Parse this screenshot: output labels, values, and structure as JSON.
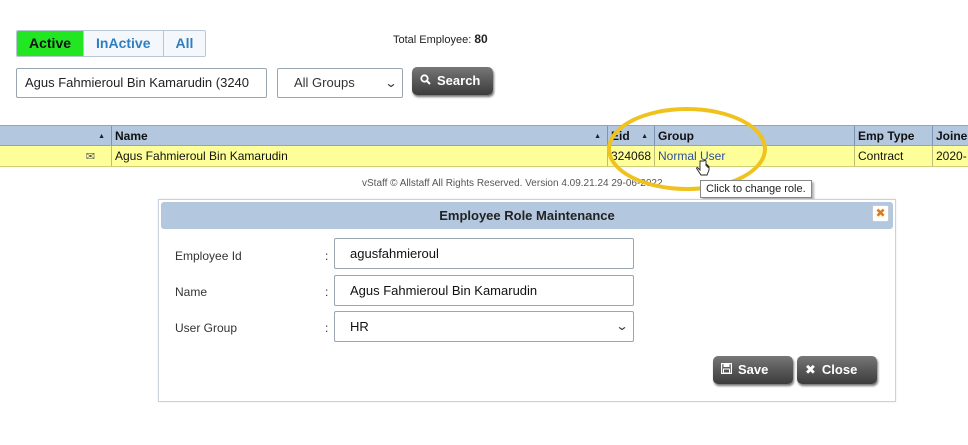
{
  "filters": {
    "tabs": [
      "Active",
      "InActive",
      "All"
    ],
    "active": "Active"
  },
  "summary": {
    "label": "Total Employee:",
    "count": "80"
  },
  "search": {
    "value": "Agus Fahmieroul Bin Kamarudin (3240",
    "group": "All Groups",
    "button": "Search"
  },
  "table": {
    "headers": [
      "",
      "Name",
      "Eid",
      "Group",
      "Emp Type",
      "Joine"
    ],
    "row": {
      "name": "Agus Fahmieroul Bin Kamarudin",
      "eid": "324068",
      "group": "Normal User",
      "emp_type": "Contract",
      "joined": "2020-"
    }
  },
  "footer": "vStaff © Allstaff All Rights Reserved. Version 4.09.21.24 29-06-2022",
  "tooltip": "Click to change role.",
  "dialog": {
    "title": "Employee Role Maintenance",
    "fields": [
      {
        "label": "Employee Id",
        "value": "agusfahmieroul"
      },
      {
        "label": "Name",
        "value": "Agus Fahmieroul Bin Kamarudin"
      },
      {
        "label": "User Group",
        "value": "HR"
      }
    ],
    "colon": ":",
    "save": "Save",
    "close": "Close"
  },
  "colors": {
    "active_tab": "#22e622",
    "header": "#b3c7df",
    "row_highlight": "#ffff99",
    "annotation": "#f0c21e"
  }
}
